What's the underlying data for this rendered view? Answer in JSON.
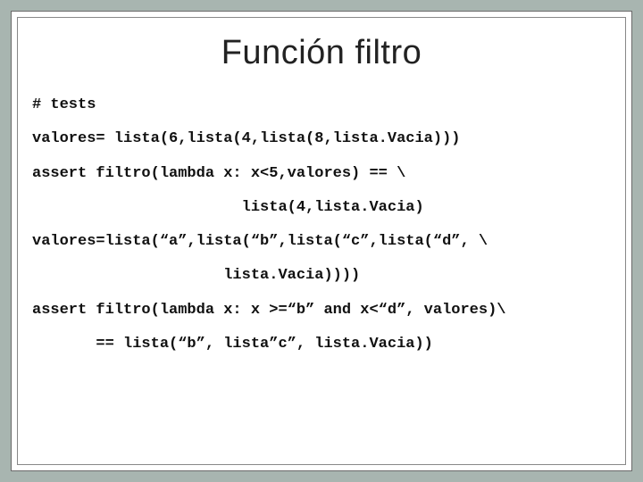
{
  "slide": {
    "title": "Función filtro",
    "code_lines": [
      "# tests",
      "valores= lista(6,lista(4,lista(8,lista.Vacia)))",
      "assert filtro(lambda x: x<5,valores) == \\",
      "                       lista(4,lista.Vacia)",
      "valores=lista(“a”,lista(“b”,lista(“c”,lista(“d”, \\",
      "                     lista.Vacia))))",
      "assert filtro(lambda x: x >=“b” and x<“d”, valores)\\",
      "       == lista(“b”, lista”c”, lista.Vacia))"
    ]
  }
}
